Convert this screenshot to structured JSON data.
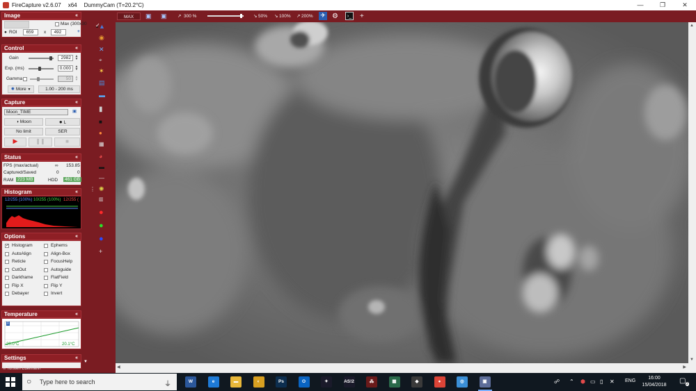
{
  "window": {
    "app_name": "FireCapture v2.6.07",
    "arch": "x64",
    "camera": "DummyCam (T=20.2°C)",
    "controls": {
      "minimize": "—",
      "maximize": "❐",
      "close": "✕"
    }
  },
  "image_section": {
    "title": "Image",
    "max_label": "Max (300x30",
    "roi_label": "ROI",
    "roi_width": "659",
    "roi_x": "x",
    "roi_height": "492",
    "roi_plus": "+"
  },
  "control_section": {
    "title": "Control",
    "gain_label": "Gain",
    "gain_value": "2982",
    "gain_level": 0.9,
    "exp_label": "Exp. (ms)",
    "exp_value": "0.000",
    "exp_level": 0.45,
    "gamma_label": "Gamma",
    "gamma_value": "50",
    "gamma_level": 0.35,
    "more_label": "More",
    "range_label": "1.00 - 200 ms"
  },
  "capture_section": {
    "title": "Capture",
    "profile_value": "Moon_TIME",
    "object_label": "Moon",
    "filter_label": "L",
    "limit_label": "No limit",
    "format_label": "SER"
  },
  "status_section": {
    "title": "Status",
    "fps_label": "FPS (max/actual)",
    "fps_value": "153.85",
    "fps_symbol": "∞",
    "captured_label": "Captured/Saved",
    "captured_value": "0",
    "saved_value": "0",
    "ram_label": "RAM",
    "ram_value": "223 MB",
    "hdd_label": "HDD",
    "hdd_value": "461 GB"
  },
  "histogram_section": {
    "title": "Histogram",
    "readout_1": "12/255 (100%)",
    "readout_2": "10/255 (100%)",
    "readout_3": "12/255 ("
  },
  "options_section": {
    "title": "Options",
    "items": [
      {
        "label": "Histogram",
        "checked": true
      },
      {
        "label": "Ephems",
        "checked": false
      },
      {
        "label": "AutoAlign",
        "checked": false
      },
      {
        "label": "Align-Box",
        "checked": false
      },
      {
        "label": "Reticle",
        "checked": false
      },
      {
        "label": "FocusHelp",
        "checked": false
      },
      {
        "label": "CutOut",
        "checked": false
      },
      {
        "label": "Autoguide",
        "checked": false
      },
      {
        "label": "Darkframe",
        "checked": false
      },
      {
        "label": "FlatField",
        "checked": false
      },
      {
        "label": "Flip X",
        "checked": false
      },
      {
        "label": "Flip Y",
        "checked": false
      },
      {
        "label": "Debayer",
        "checked": false
      },
      {
        "label": "Invert",
        "checked": false
      }
    ]
  },
  "temperature_section": {
    "title": "Temperature",
    "min_label": "20.0°C",
    "max_label": "20.1°C",
    "marker": "0"
  },
  "settings_section": {
    "title": "Settings"
  },
  "copyright": "© Torsten Edelmann",
  "toolbar": {
    "max_label": "MAX",
    "zoom_label": "300 %",
    "zoom_level": 0.95,
    "zoom_50": "50%",
    "zoom_100": "100%",
    "zoom_200": "200%",
    "plus": "+"
  },
  "taskbar": {
    "search_placeholder": "Type here to search",
    "apps": [
      {
        "name": "word",
        "label": "W",
        "color": "#2b579a"
      },
      {
        "name": "edge",
        "label": "e",
        "color": "#1e7ad6"
      },
      {
        "name": "explorer",
        "label": "▬",
        "color": "#e8b73a"
      },
      {
        "name": "app-round",
        "label": "◐",
        "color": "#d9a021"
      },
      {
        "name": "photoshop",
        "label": "Ps",
        "color": "#0d2e4f"
      },
      {
        "name": "outlook",
        "label": "O",
        "color": "#0a64c2"
      },
      {
        "name": "stellarium",
        "label": "✦",
        "color": "#1a1a2a"
      },
      {
        "name": "as2",
        "label": "AS!2",
        "color": "#1a1a2a"
      },
      {
        "name": "registax",
        "label": "⁂",
        "color": "#6a1a1a"
      },
      {
        "name": "app-grid",
        "label": "▦",
        "color": "#2a6a4a"
      },
      {
        "name": "app-colors",
        "label": "◆",
        "color": "#3a3a3a"
      },
      {
        "name": "chrome",
        "label": "●",
        "color": "#db4437"
      },
      {
        "name": "app-blue",
        "label": "◎",
        "color": "#3b8fd6"
      },
      {
        "name": "firecapture",
        "label": "▣",
        "color": "#5d6d99"
      }
    ],
    "language": "ENG",
    "time": "16:00",
    "date": "15/04/2018",
    "notifications": "2"
  }
}
